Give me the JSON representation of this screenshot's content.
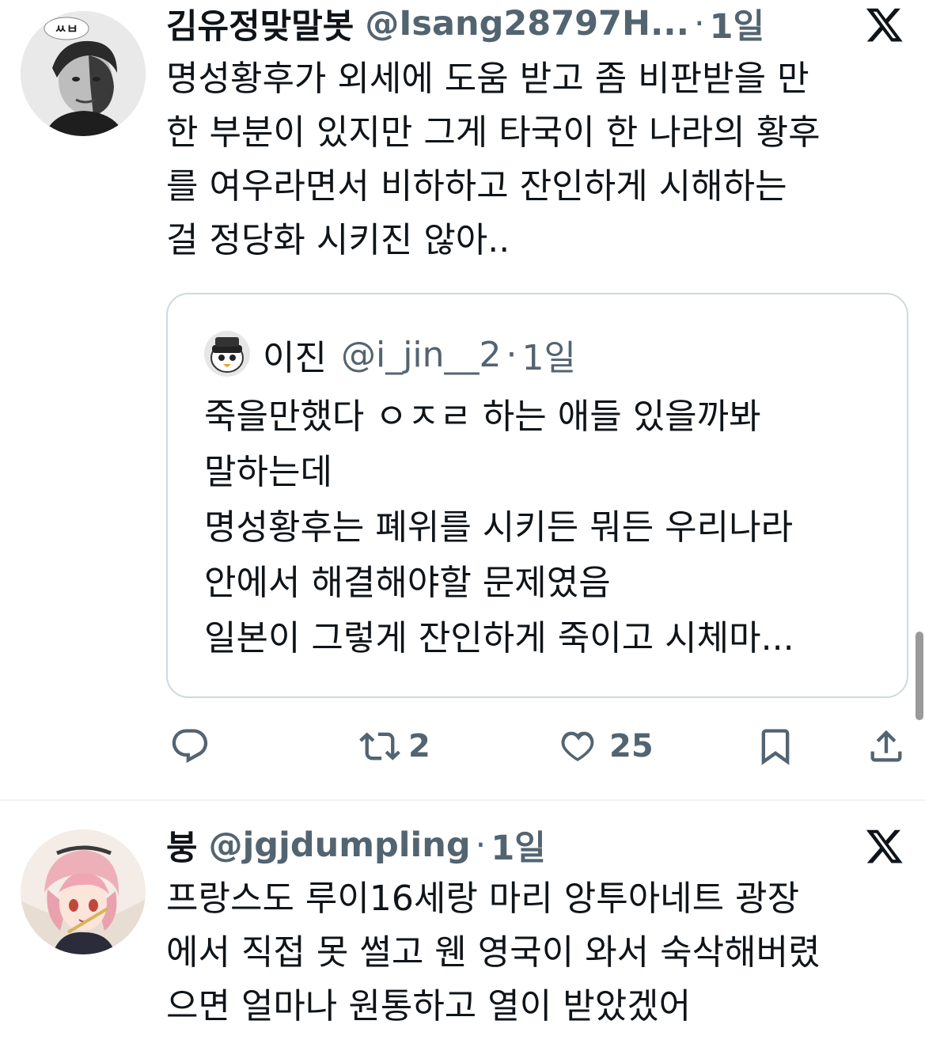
{
  "colors": {
    "text": "#0f1419",
    "muted": "#536471",
    "border": "#cfd9de"
  },
  "tweets": [
    {
      "name": "김유정맞말봇",
      "handle": "@Isang28797H...",
      "time": "1일",
      "avatar_label": "ㅆㅂ",
      "text": "명성황후가 외세에 도움 받고 좀 비판받을 만\n한 부분이 있지만 그게 타국이 한 나라의 황후\n를 여우라면서 비하하고 잔인하게 시해하는\n걸 정당화 시키진 않아..",
      "quote": {
        "name": "이진",
        "handle": "@i_jin__2",
        "time": "1일",
        "text": "죽을만했다 ㅇㅈㄹ 하는 애들 있을까봐\n말하는데\n명성황후는 폐위를 시키든 뭐든 우리나라\n안에서 해결해야할 문제였음\n일본이 그렇게 잔인하게 죽이고 시체마..."
      },
      "actions": {
        "reply_count": "",
        "retweet_count": "2",
        "like_count": "25"
      }
    },
    {
      "name": "붕",
      "handle": "@jgjdumpling",
      "time": "1일",
      "text": "프랑스도 루이16세랑 마리 앙투아네트 광장\n에서 직접 못 썰고 웬 영국이 와서 숙삭해버렸\n으면 얼마나 원통하고 열이 받았겠어"
    }
  ]
}
